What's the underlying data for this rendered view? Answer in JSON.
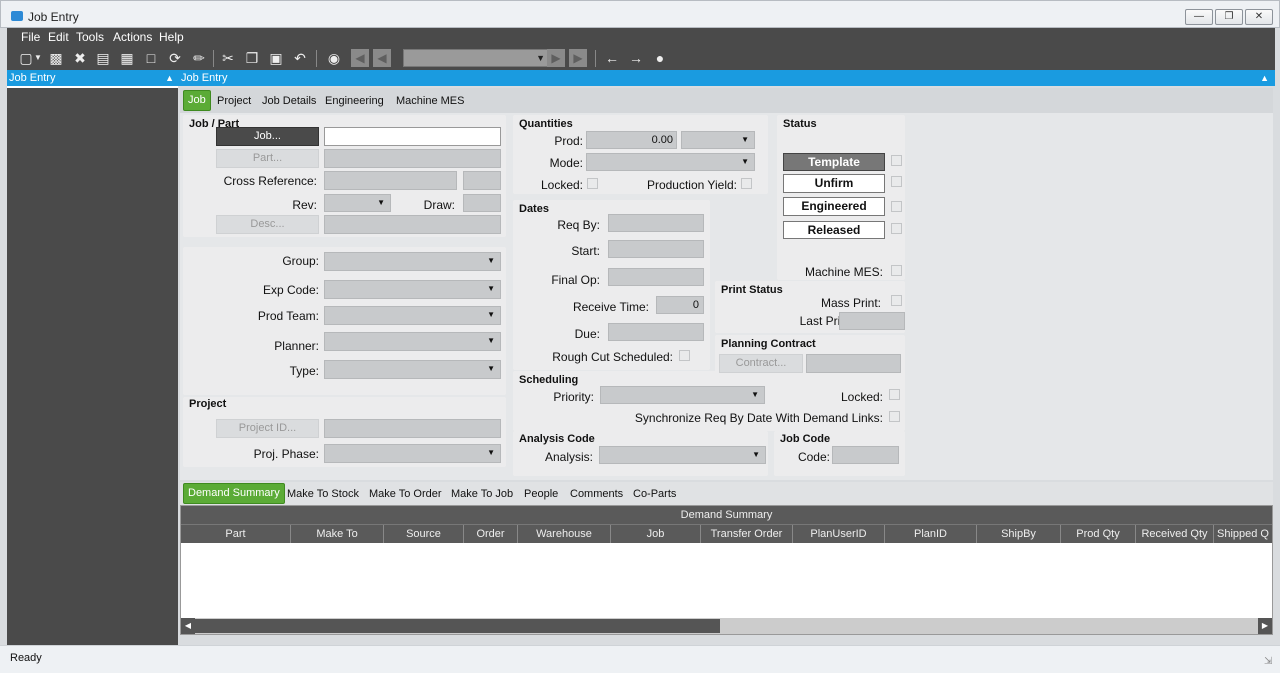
{
  "window": {
    "title": "Job Entry",
    "buttons": [
      "minimize",
      "restore",
      "close"
    ]
  },
  "menu": [
    "File",
    "Edit",
    "Tools",
    "Actions",
    "Help"
  ],
  "toolbar_icons": [
    "new-icon",
    "dropdown-arrow-icon",
    "save-icon",
    "delete-icon",
    "book-icon",
    "grid-icon",
    "note-icon",
    "refresh-icon",
    "brush-icon",
    "cut-icon",
    "copy-icon",
    "paste-icon",
    "undo-icon",
    "binoculars-icon",
    "first-icon",
    "prev-icon",
    "next-icon",
    "last-icon",
    "back-icon",
    "forward-icon",
    "home-icon"
  ],
  "left_panel": {
    "title": "Job Entry"
  },
  "main_panel": {
    "title": "Job Entry"
  },
  "tabs": [
    "Job",
    "Project",
    "Job Details",
    "Engineering",
    "Machine MES"
  ],
  "job_part": {
    "caption": "Job / Part",
    "job_btn": "Job...",
    "part_btn": "Part...",
    "cross_ref": "Cross Reference:",
    "rev": "Rev:",
    "draw": "Draw:",
    "desc_btn": "Desc..."
  },
  "group_section": {
    "group": "Group:",
    "exp_code": "Exp Code:",
    "prod_team": "Prod Team:",
    "planner": "Planner:",
    "type": "Type:"
  },
  "project": {
    "caption": "Project",
    "project_id_btn": "Project ID...",
    "proj_phase": "Proj. Phase:"
  },
  "quantities": {
    "caption": "Quantities",
    "prod": "Prod:",
    "prod_value": "0.00",
    "mode": "Mode:",
    "locked": "Locked:",
    "production_yield": "Production Yield:"
  },
  "dates": {
    "caption": "Dates",
    "req_by": "Req By:",
    "start": "Start:",
    "final_op": "Final Op:",
    "receive_time": "Receive Time:",
    "receive_time_value": "0",
    "due": "Due:",
    "rough_cut": "Rough Cut Scheduled:"
  },
  "scheduling": {
    "caption": "Scheduling",
    "priority": "Priority:",
    "locked": "Locked:",
    "sync": "Synchronize Req By Date With Demand Links:"
  },
  "analysis": {
    "caption": "Analysis Code",
    "analysis": "Analysis:"
  },
  "status": {
    "caption": "Status",
    "template": "Template",
    "unfirm": "Unfirm",
    "engineered": "Engineered",
    "released": "Released",
    "machine_mes": "Machine MES:"
  },
  "print_status": {
    "caption": "Print Status",
    "mass_print": "Mass Print:",
    "last_printed": "Last Printed:"
  },
  "planning_contract": {
    "caption": "Planning Contract",
    "contract_btn": "Contract..."
  },
  "job_code": {
    "caption": "Job Code",
    "code": "Code:"
  },
  "bottom_tabs": [
    "Demand Summary",
    "Make To Stock",
    "Make To Order",
    "Make To Job",
    "People",
    "Comments",
    "Co-Parts"
  ],
  "grid": {
    "band": "Demand Summary",
    "columns": [
      "Part",
      "Make To",
      "Source",
      "Order",
      "Warehouse",
      "Job",
      "Transfer Order",
      "PlanUserID",
      "PlanID",
      "ShipBy",
      "Prod Qty",
      "Received Qty",
      "Shipped Q"
    ]
  },
  "statusbar": {
    "text": "Ready"
  },
  "colors": {
    "accent_blue": "#1a9be0",
    "active_tab_green": "#5bab36",
    "dark_chrome": "#4a4a4a"
  }
}
